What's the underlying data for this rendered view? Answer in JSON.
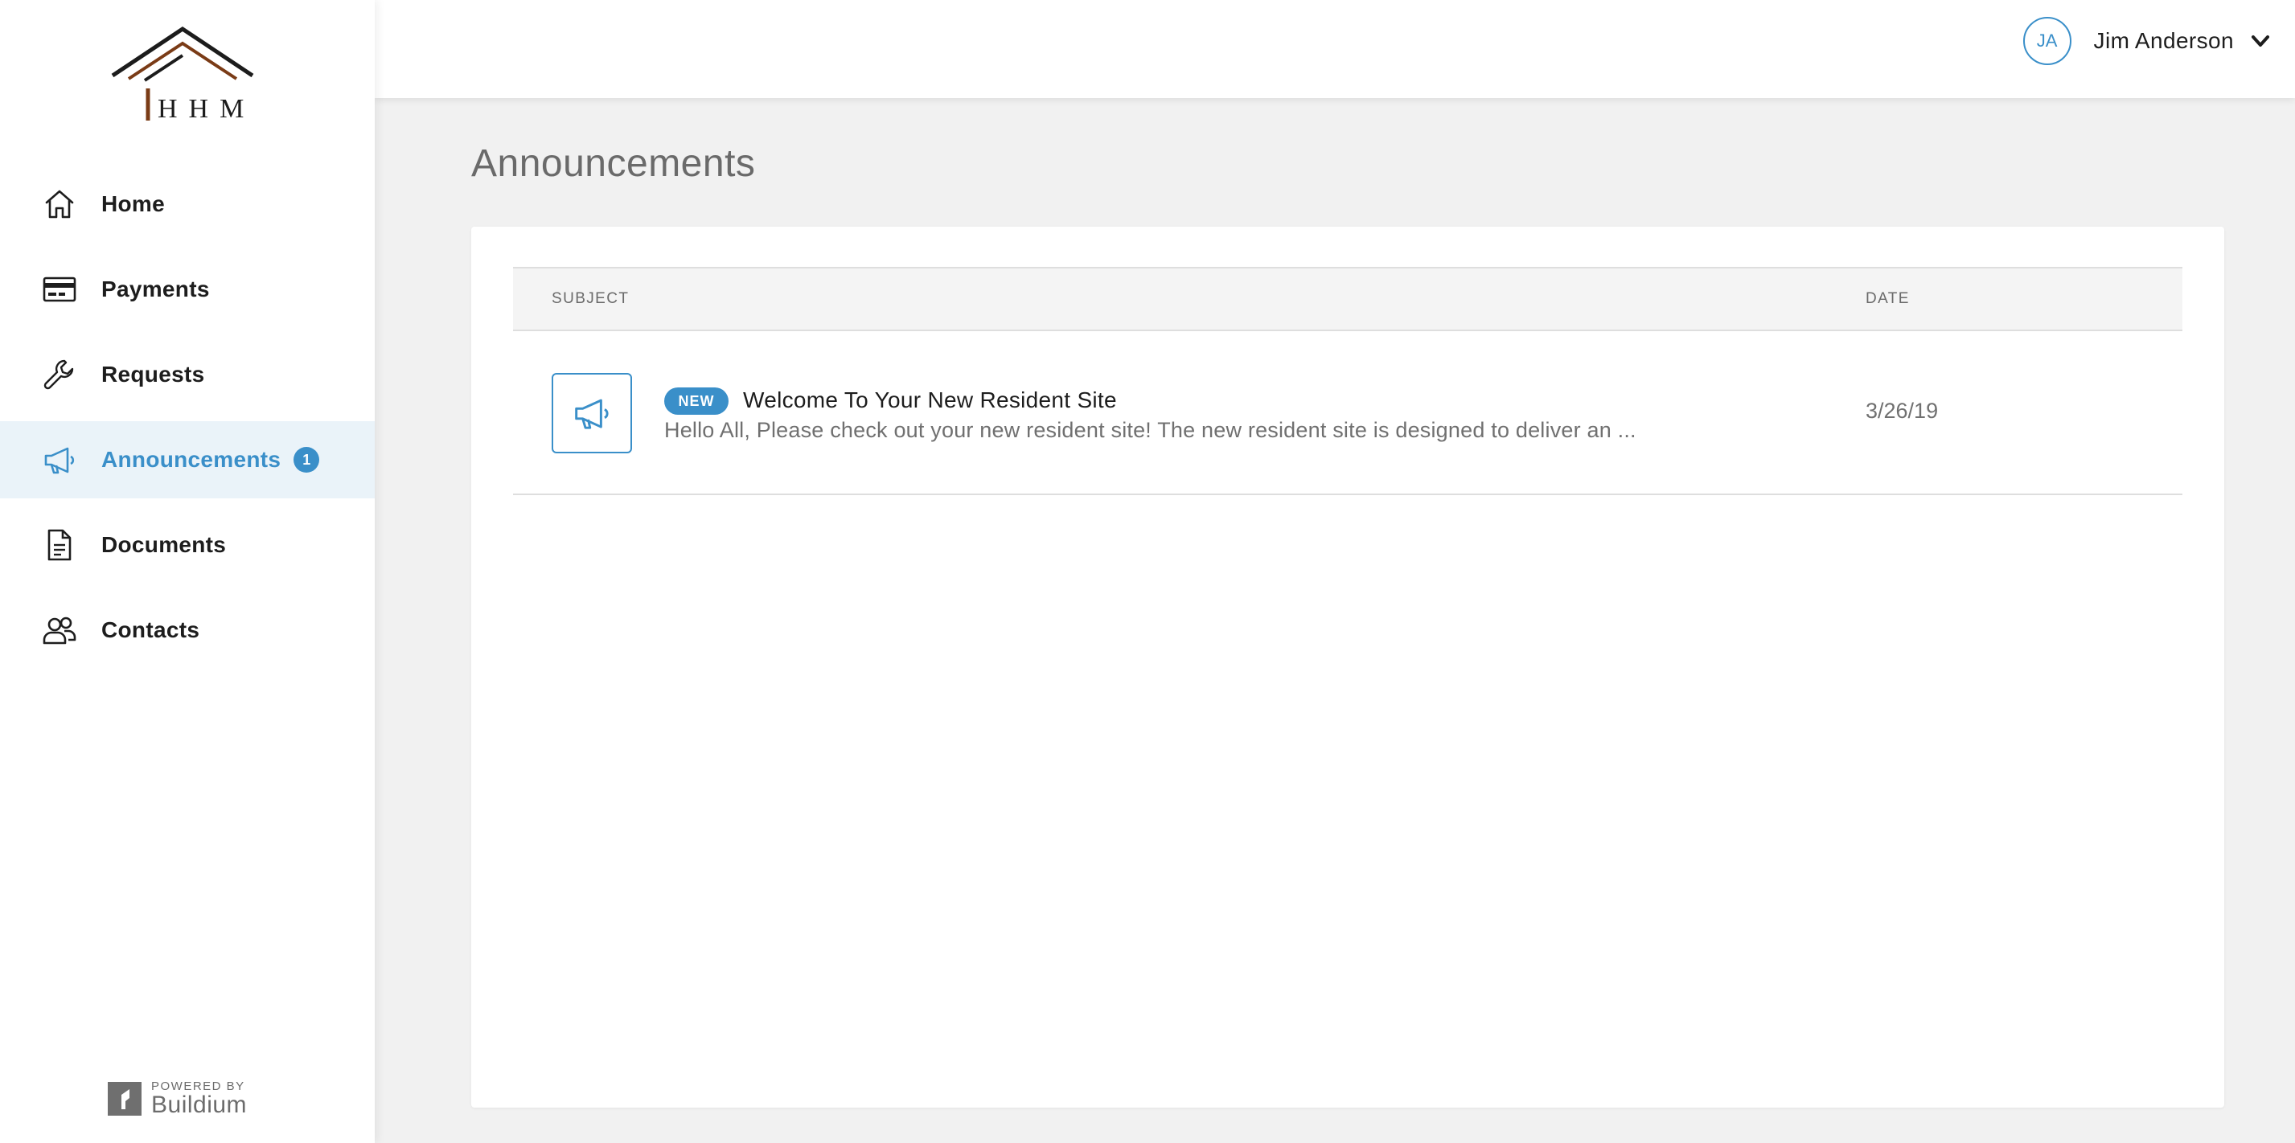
{
  "brand": {
    "logo_text": "HHM",
    "powered_by": "POWERED BY",
    "powered_brand": "Buildium"
  },
  "sidebar": {
    "items": [
      {
        "label": "Home",
        "icon": "home-icon",
        "active": false
      },
      {
        "label": "Payments",
        "icon": "credit-card-icon",
        "active": false
      },
      {
        "label": "Requests",
        "icon": "wrench-icon",
        "active": false
      },
      {
        "label": "Announcements",
        "icon": "megaphone-icon",
        "active": true,
        "badge": "1"
      },
      {
        "label": "Documents",
        "icon": "document-icon",
        "active": false
      },
      {
        "label": "Contacts",
        "icon": "contacts-icon",
        "active": false
      }
    ]
  },
  "header": {
    "user_initials": "JA",
    "user_name": "Jim Anderson"
  },
  "page": {
    "title": "Announcements"
  },
  "table": {
    "columns": [
      "SUBJECT",
      "DATE"
    ],
    "rows": [
      {
        "badge": "NEW",
        "title": "Welcome To Your New Resident Site",
        "snippet": "Hello All, Please check out your new resident site! The new resident site is designed to deliver an ...",
        "date": "3/26/19"
      }
    ]
  },
  "colors": {
    "accent": "#3a8fc9",
    "active_bg": "#eaf3f9",
    "page_bg": "#f1f1f1",
    "logo_dark": "#1c1c1c",
    "logo_brown": "#7a3b16"
  }
}
